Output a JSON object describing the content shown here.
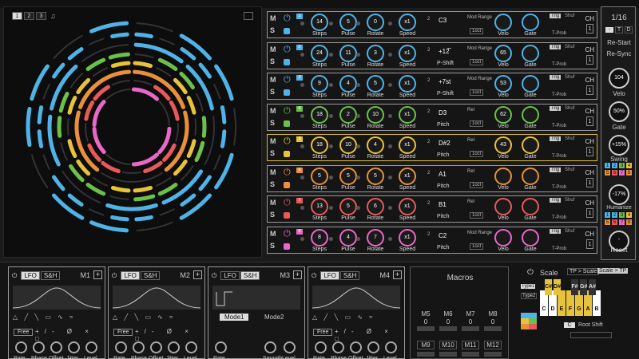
{
  "top": {
    "pattern_buttons": [
      "1",
      "2",
      "3"
    ]
  },
  "tracks": [
    {
      "ms": [
        "M",
        "S"
      ],
      "tag": "1",
      "tag_color": "#4fb3e8",
      "color": "#4fb3e8",
      "steps": "14",
      "pulse": "5",
      "rotate": "0",
      "speed": "x1",
      "len": "2",
      "pitch": "C3",
      "pitch_label": "",
      "mod": "Mod Range",
      "oct": "1oct",
      "velo": "",
      "gate": "",
      "trig": "Trig",
      "shuf": "Shuf",
      "ch": "1",
      "extra": "T-Prob"
    },
    {
      "ms": [
        "M",
        "S"
      ],
      "tag": "2",
      "tag_color": "#4fb3e8",
      "color": "#4fb3e8",
      "steps": "24",
      "pulse": "11",
      "rotate": "3",
      "speed": "x1",
      "len": "2",
      "pitch": "+12̅",
      "pitch_label": "P-Shift",
      "mod": "Mod Range",
      "oct": "1oct",
      "velo": "65",
      "gate": "",
      "trig": "Trig",
      "shuf": "Shuf",
      "ch": "1",
      "extra": "T-Prob"
    },
    {
      "ms": [
        "M",
        "S"
      ],
      "tag": "3",
      "tag_color": "#4fb3e8",
      "color": "#4fb3e8",
      "steps": "9",
      "pulse": "4",
      "rotate": "5",
      "speed": "x1",
      "len": "2",
      "pitch": "+7st",
      "pitch_label": "P-Shift",
      "mod": "Mod Range",
      "oct": "1oct",
      "velo": "53",
      "gate": "",
      "trig": "Trig",
      "shuf": "Shuf",
      "ch": "1",
      "extra": "T-Prob"
    },
    {
      "ms": [
        "M",
        "S"
      ],
      "tag": "4",
      "tag_color": "#6cc04a",
      "color": "#6cc04a",
      "steps": "18",
      "pulse": "2",
      "rotate": "10",
      "speed": "x1",
      "len": "2",
      "pitch": "D3",
      "pitch_label": "Pitch",
      "mod": "Rel",
      "oct": "1oct",
      "velo": "62",
      "gate": "",
      "trig": "Trig",
      "shuf": "Shuf",
      "ch": "1",
      "extra": "T-Prob"
    },
    {
      "ms": [
        "M",
        "S"
      ],
      "tag": "5",
      "tag_color": "#e8c23a",
      "color": "#e8c23a",
      "steps": "18",
      "pulse": "10",
      "rotate": "4",
      "speed": "x1",
      "len": "2",
      "pitch": "D#2",
      "pitch_label": "Pitch",
      "mod": "Rel",
      "oct": "1oct",
      "velo": "43",
      "gate": "",
      "trig": "Trig",
      "shuf": "Shuf",
      "ch": "1",
      "extra": "T-Prob"
    },
    {
      "ms": [
        "M",
        "S"
      ],
      "tag": "6",
      "tag_color": "#e8913a",
      "color": "#e8913a",
      "steps": "5",
      "pulse": "5",
      "rotate": "5",
      "speed": "x1",
      "len": "2",
      "pitch": "A1",
      "pitch_label": "Pitch",
      "mod": "Rel",
      "oct": "1oct",
      "velo": "",
      "gate": "",
      "trig": "Trig",
      "shuf": "Shuf",
      "ch": "1",
      "extra": "T-Prob"
    },
    {
      "ms": [
        "M",
        "S"
      ],
      "tag": "7",
      "tag_color": "#e85a5a",
      "color": "#e85a5a",
      "steps": "13",
      "pulse": "5",
      "rotate": "6",
      "speed": "x1",
      "len": "2",
      "pitch": "B1",
      "pitch_label": "Pitch",
      "mod": "Rel",
      "oct": "1oct",
      "velo": "",
      "gate": "",
      "trig": "Trig",
      "shuf": "Shuf",
      "ch": "1",
      "extra": "T-Prob"
    },
    {
      "ms": [
        "M",
        "S"
      ],
      "tag": "8",
      "tag_color": "#e868c8",
      "color": "#e868c8",
      "steps": "8",
      "pulse": "4",
      "rotate": "7",
      "speed": "x1",
      "len": "2",
      "pitch": "C2",
      "pitch_label": "Pitch",
      "mod": "Mod Range",
      "oct": "1oct",
      "velo": "",
      "gate": "",
      "trig": "Trig",
      "shuf": "Shuf",
      "ch": "1",
      "extra": "T-Prob"
    }
  ],
  "labels": {
    "steps": "Steps",
    "pulse": "Pulse",
    "rotate": "Rotate",
    "speed": "Speed",
    "velo": "Velo",
    "gate": "Gate",
    "ch": "CH"
  },
  "right": {
    "div": "1/16",
    "minus": "-",
    "t": "T",
    "d": "D",
    "restart": "Re-Start",
    "resync": "Re-Sync",
    "velo_val": "104",
    "velo": "Velo",
    "gate_val": "50%",
    "gate": "Gate",
    "swing_val": "+15%",
    "swing": "Swing",
    "humanize_val": "-17%",
    "humanize": "Humanize",
    "reset": "Reset",
    "swing_grid": [
      "1",
      "2",
      "3",
      "4",
      "5",
      "6",
      "7",
      "8"
    ],
    "human_grid": [
      "1",
      "2",
      "3",
      "4",
      "5",
      "6",
      "7",
      "8"
    ]
  },
  "mods": [
    {
      "lfo": "LFO",
      "sh": "S&H",
      "name": "M1",
      "active": "LFO",
      "free": "Free",
      "labels": [
        "Rate",
        "Phase",
        "Offset",
        "Jitter",
        "Level"
      ]
    },
    {
      "lfo": "LFO",
      "sh": "S&H",
      "name": "M2",
      "active": "LFO",
      "free": "Free",
      "labels": [
        "Rate",
        "Phase",
        "Offset",
        "Jitter",
        "Level"
      ]
    },
    {
      "lfo": "LFO",
      "sh": "S&H",
      "name": "M3",
      "active": "S&H",
      "mode1": "Mode1",
      "mode2": "Mode2",
      "labels": [
        "Rate",
        "Smooth",
        "Level"
      ]
    },
    {
      "lfo": "LFO",
      "sh": "S&H",
      "name": "M4",
      "active": "LFO",
      "free": "Free",
      "labels": [
        "Rate",
        "Phase",
        "Offset",
        "Jitter",
        "Level"
      ]
    }
  ],
  "macros": {
    "title": "Macros",
    "row1": [
      "M5",
      "M6",
      "M7",
      "M8"
    ],
    "row1_vals": [
      "0",
      "0",
      "0",
      "0"
    ],
    "row2": [
      "M9",
      "M10",
      "M11",
      "M12"
    ]
  },
  "scale": {
    "title": "Scale",
    "tp_scale": "TP > Scale",
    "scale_tp": "Scale > TP",
    "type1": "Type1",
    "type2": "Type2",
    "keys_black": [
      "C#",
      "D#",
      "F#",
      "G#",
      "A#"
    ],
    "keys_white": [
      "C",
      "D",
      "E",
      "F",
      "G",
      "A",
      "B"
    ],
    "root": "C",
    "root_shift": "Root Shift"
  }
}
